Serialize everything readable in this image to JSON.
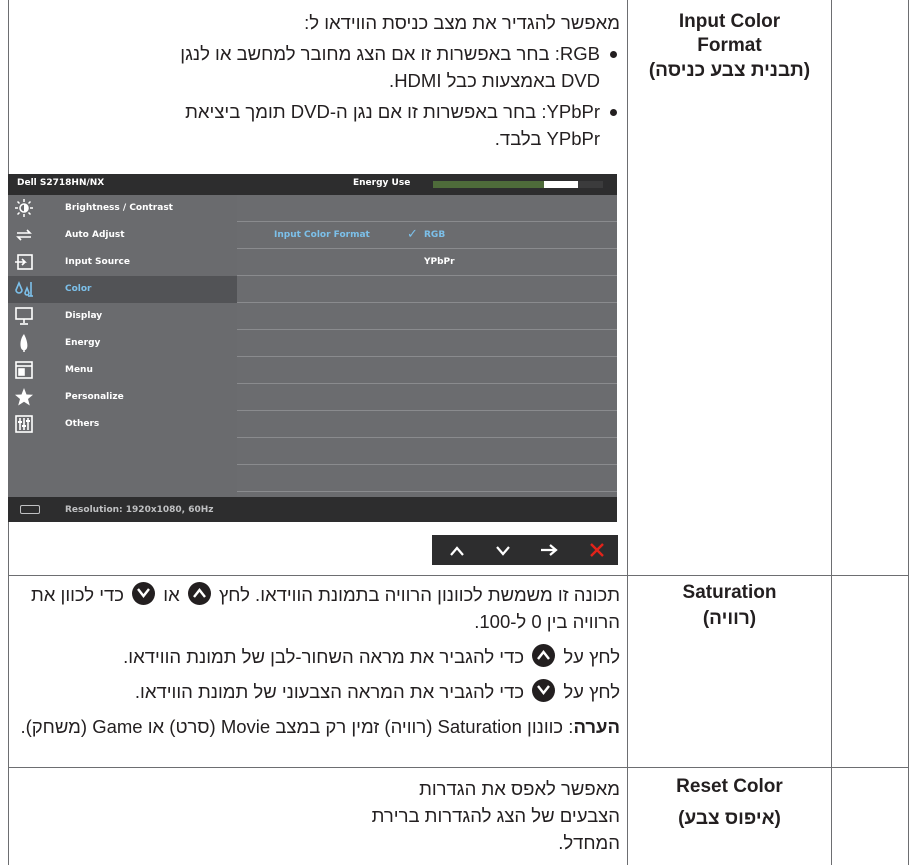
{
  "rows": [
    {
      "label_en": "Input Color Format",
      "label_he": "(תבנית צבע כניסה)",
      "intro": "מאפשר להגדיר את מצב כניסת הווידאו ל:",
      "bullets": [
        "RGB: בחר באפשרות זו אם הצג מחובר למחשב או לנגן DVD באמצעות כבל HDMI.",
        "YPbPr: בחר באפשרות זו אם נגן ה-DVD תומך ביציאת YPbPr בלבד."
      ]
    },
    {
      "label_en": "Saturation",
      "label_he": "(רוויה)",
      "para1_a": "תכונה זו משמשת לכוונון הרוויה בתמונת הווידאו. לחץ",
      "para1_b": "או",
      "para1_c": "כדי לכוון את הרוויה בין 0 ל-100.",
      "para2_a": "לחץ על",
      "para2_b": "כדי להגביר את מראה השחור-לבן של תמונת הווידאו.",
      "para3_a": "לחץ על",
      "para3_b": "כדי להגביר את המראה הצבעוני של תמונת הווידאו.",
      "note_label": "הערה",
      "note_text": ": כוונון Saturation (רוויה) זמין רק במצב Movie (סרט) או Game (משחק)."
    },
    {
      "label_en": "Reset Color",
      "label_he": "(איפוס צבע)",
      "desc": "מאפשר לאפס את הגדרות הצבעים של הצג להגדרות ברירת המחדל."
    }
  ],
  "osd": {
    "model": "Dell S2718HN/NX",
    "energy_label": "Energy Use",
    "energy_level": 0.85,
    "menu": [
      {
        "label": "Brightness / Contrast",
        "icon": "brightness-icon"
      },
      {
        "label": "Auto Adjust",
        "icon": "auto-adjust-icon"
      },
      {
        "label": "Input Source",
        "icon": "input-source-icon"
      },
      {
        "label": "Color",
        "icon": "color-icon"
      },
      {
        "label": "Display",
        "icon": "display-icon"
      },
      {
        "label": "Energy",
        "icon": "energy-icon"
      },
      {
        "label": "Menu",
        "icon": "menu-icon"
      },
      {
        "label": "Personalize",
        "icon": "star-icon"
      },
      {
        "label": "Others",
        "icon": "others-icon"
      }
    ],
    "selected_menu": "Color",
    "submenu_title": "Input Color Format",
    "options": [
      "RGB",
      "YPbPr"
    ],
    "selected_option": "RGB",
    "check_mark": "✓",
    "resolution": "Resolution: 1920x1080, 60Hz"
  },
  "nav_buttons": [
    {
      "name": "up",
      "glyph": "∧"
    },
    {
      "name": "down",
      "glyph": "∨"
    },
    {
      "name": "next",
      "glyph": "→"
    },
    {
      "name": "close",
      "glyph": "✕"
    }
  ],
  "colors": {
    "text": "#231f20",
    "osd_selected": "#7cc0ea",
    "close_red": "#e2231a"
  }
}
